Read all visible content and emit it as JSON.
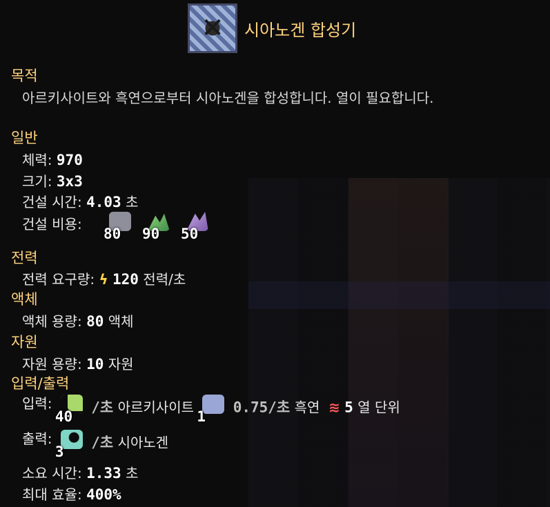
{
  "block": {
    "title": "시아노겐 합성기",
    "icon": "cyanogen-synthesizer-icon"
  },
  "sections": {
    "purpose": "목적",
    "general": "일반",
    "power": "전력",
    "liquids": "액체",
    "items": "자원",
    "io": "입력/출력"
  },
  "description": "아르키사이트와 흑연으로부터 시아노겐을 합성합니다. 열이 필요합니다.",
  "general": {
    "health_label": "체력: ",
    "health_value": "970",
    "size_label": "크기: ",
    "size_value": "3x3",
    "build_time_label": "건설 시간: ",
    "build_time_value": "4.03",
    "build_time_unit": " 초",
    "build_cost_label": "건설 비용:",
    "build_cost": [
      {
        "amount": "80",
        "icon": "gray-rock-icon"
      },
      {
        "amount": "90",
        "icon": "green-crystal-icon"
      },
      {
        "amount": "50",
        "icon": "purple-crystal-icon"
      }
    ]
  },
  "power": {
    "label": "전력 요구량: ",
    "icon": "lightning-icon",
    "value": "120",
    "unit": " 전력/초"
  },
  "liquids": {
    "label": "액체 용량: ",
    "value": "80",
    "unit": " 액체"
  },
  "items": {
    "label": "자원 용량: ",
    "value": "10",
    "unit": " 자원"
  },
  "io": {
    "input_label": "입력:",
    "input_1_amount": "40",
    "input_1_rate": "/초",
    "input_1_name": "아르키사이트",
    "input_2_amount": "1",
    "input_2_rate": "0.75/초",
    "input_2_name": "흑연",
    "heat_icon": "≋",
    "heat_value": "5",
    "heat_unit": " 열 단위",
    "output_label": "출력:",
    "output_amount": "3",
    "output_rate": "/초",
    "output_name": "시아노겐",
    "craft_time_label": "소요 시간: ",
    "craft_time_value": "1.33",
    "craft_time_unit": " 초",
    "efficiency_label": "최대 효율: ",
    "efficiency_value": "400%"
  },
  "colors": {
    "section": "#ffd37f",
    "title": "#ffd37f",
    "power": "#ffd24a",
    "heat": "#ff5a5a"
  }
}
